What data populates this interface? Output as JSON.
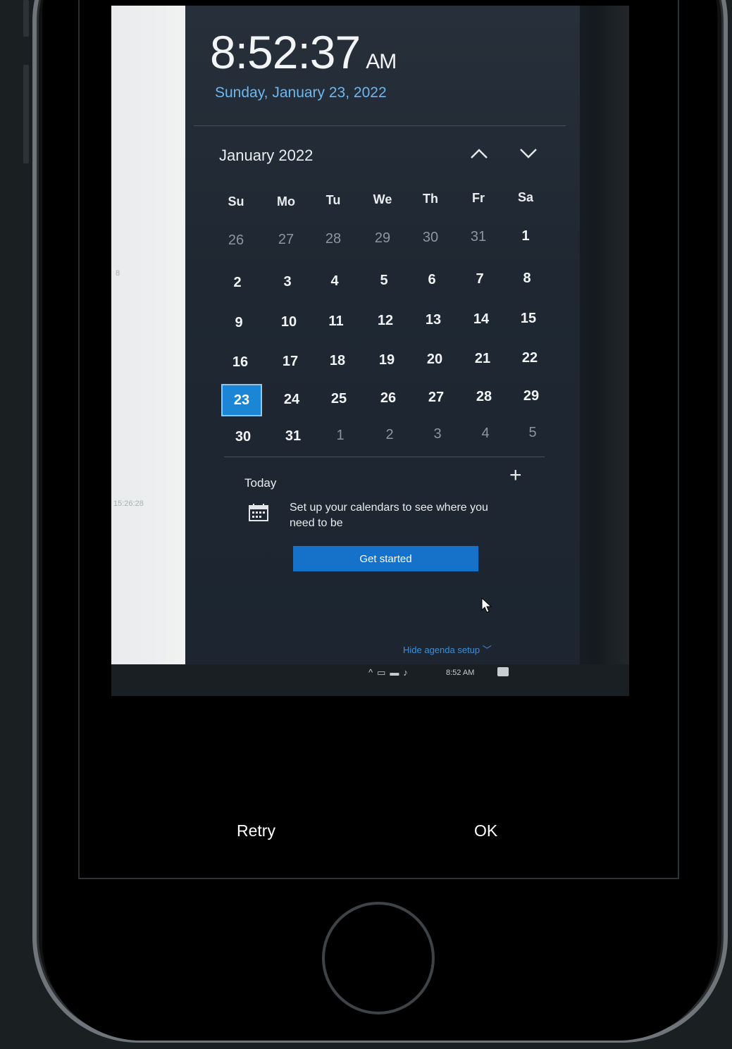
{
  "photo": {
    "clock": {
      "time": "8:52:37",
      "ampm": "AM"
    },
    "date": "Sunday, January 23, 2022",
    "calendar": {
      "month_label": "January 2022",
      "weekdays": [
        "Su",
        "Mo",
        "Tu",
        "We",
        "Th",
        "Fr",
        "Sa"
      ],
      "weeks": [
        [
          "26",
          "27",
          "28",
          "29",
          "30",
          "31",
          "1"
        ],
        [
          "2",
          "3",
          "4",
          "5",
          "6",
          "7",
          "8"
        ],
        [
          "9",
          "10",
          "11",
          "12",
          "13",
          "14",
          "15"
        ],
        [
          "16",
          "17",
          "18",
          "19",
          "20",
          "21",
          "22"
        ],
        [
          "23",
          "24",
          "25",
          "26",
          "27",
          "28",
          "29"
        ],
        [
          "30",
          "31",
          "1",
          "2",
          "3",
          "4",
          "5"
        ]
      ],
      "selected_day": "23"
    },
    "agenda": {
      "today_label": "Today",
      "plus": "+",
      "message": "Set up your calendars to see where you need to be",
      "button_label": "Get started",
      "hide_label": "Hide agenda setup ﹀"
    },
    "taskbar": {
      "time": "8:52 AM"
    },
    "paper": {
      "snippet_1": "8",
      "snippet_2": "15:26:28"
    }
  },
  "actions": {
    "retry_label": "Retry",
    "ok_label": "OK"
  },
  "colors": {
    "accent": "#1b86d6",
    "link": "#3c8fd8",
    "button": "#1672c9"
  }
}
